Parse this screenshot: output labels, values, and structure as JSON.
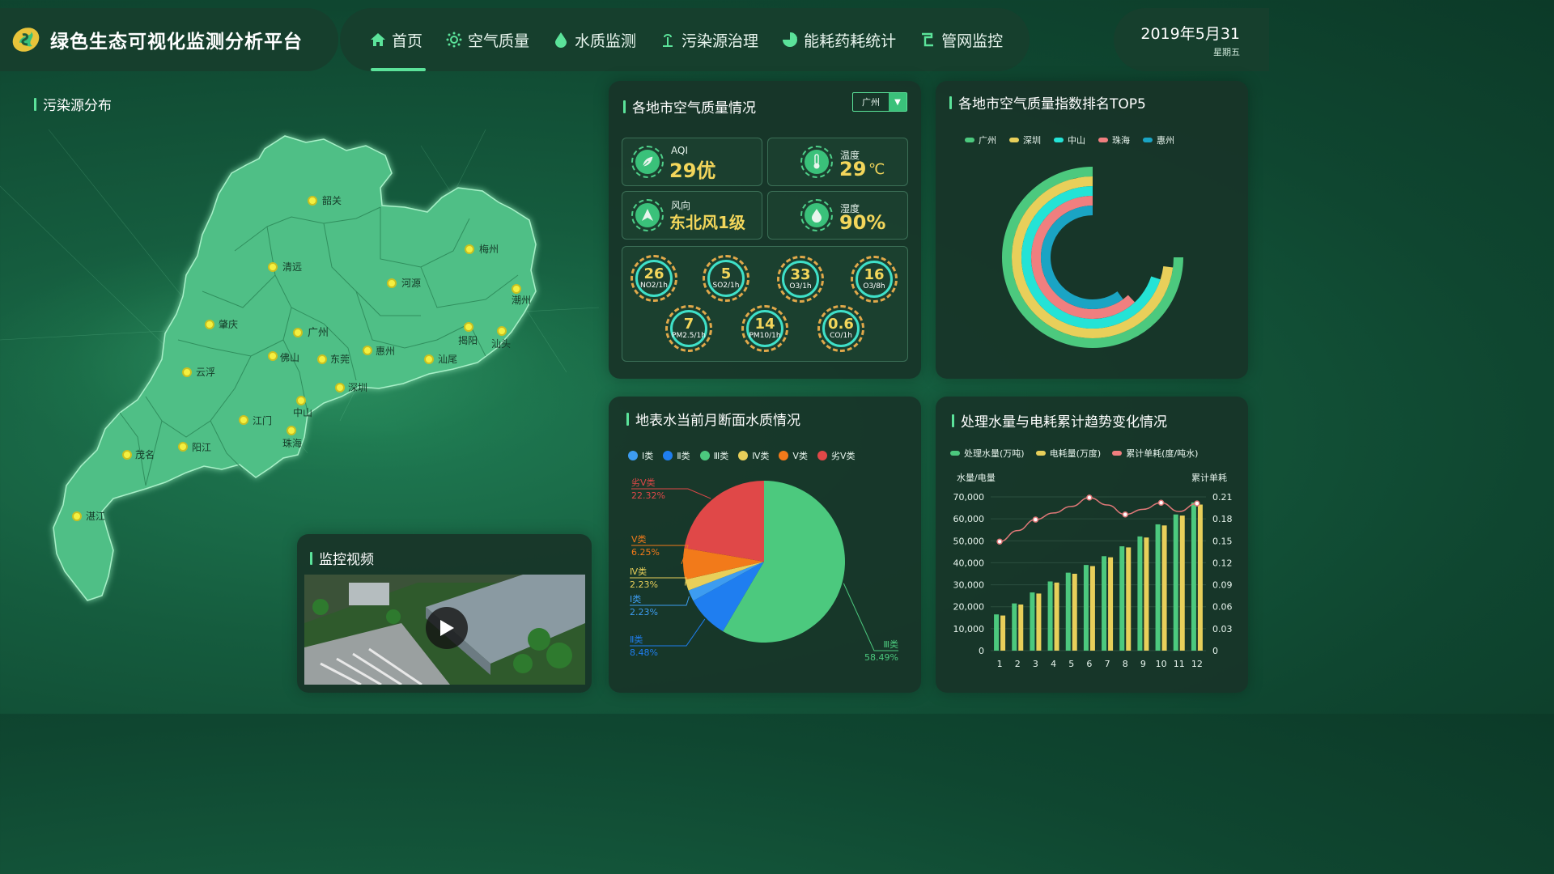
{
  "header": {
    "title": "绿色生态可视化监测分析平台",
    "nav": [
      {
        "label": "首页",
        "icon": "home-icon",
        "active": true
      },
      {
        "label": "空气质量",
        "icon": "air-icon"
      },
      {
        "label": "水质监测",
        "icon": "water-drop-icon"
      },
      {
        "label": "污染源治理",
        "icon": "pollution-icon"
      },
      {
        "label": "能耗药耗统计",
        "icon": "pie-icon"
      },
      {
        "label": "管网监控",
        "icon": "pipe-icon"
      }
    ],
    "date": "2019年5月31",
    "weekday": "星期五"
  },
  "map": {
    "title": "污染源分布",
    "cities": [
      "韶关",
      "清远",
      "梅州",
      "河源",
      "潮州",
      "肇庆",
      "广州",
      "揭阳",
      "汕头",
      "佛山",
      "东莞",
      "惠州",
      "汕尾",
      "云浮",
      "深圳",
      "中山",
      "江门",
      "珠海",
      "茂名",
      "阳江",
      "湛江"
    ]
  },
  "video": {
    "title": "监控视频"
  },
  "air": {
    "title": "各地市空气质量情况",
    "city_select": "广州",
    "aqi_label": "AQI",
    "aqi_value": "29优",
    "temp_label": "温度",
    "temp_value": "29",
    "temp_unit": "℃",
    "wind_label": "风向",
    "wind_value": "东北风1级",
    "humidity_label": "湿度",
    "humidity_value": "90%",
    "pollutants": [
      {
        "value": "26",
        "name": "NO2/1h"
      },
      {
        "value": "5",
        "name": "SO2/1h"
      },
      {
        "value": "33",
        "name": "O3/1h"
      },
      {
        "value": "16",
        "name": "O3/8h"
      },
      {
        "value": "7",
        "name": "PM2.5/1h"
      },
      {
        "value": "14",
        "name": "PM10/1h"
      },
      {
        "value": "0.6",
        "name": "CO/1h"
      }
    ]
  },
  "ranking": {
    "title": "各地市空气质量指数排名TOP5",
    "colors": {
      "广州": "#4cc97e",
      "深圳": "#e8cf5a",
      "中山": "#24e3d6",
      "珠海": "#f07f7f",
      "惠州": "#1aa4c4"
    }
  },
  "water": {
    "title": "地表水当前月断面水质情况",
    "legend": [
      "Ⅰ类",
      "Ⅱ类",
      "Ⅲ类",
      "Ⅳ类",
      "Ⅴ类",
      "劣Ⅴ类"
    ],
    "colors": [
      "#3d9cf0",
      "#1f7ef0",
      "#4cc97e",
      "#e8cf5a",
      "#f27a1a",
      "#e04848"
    ]
  },
  "trend": {
    "title": "处理水量与电耗累计趋势变化情况",
    "legend": [
      "处理水量(万吨)",
      "电耗量(万度)",
      "累计单耗(度/吨水)"
    ],
    "left_axis_title": "水量/电量",
    "right_axis_title": "累计单耗",
    "left_ticks": [
      "70,000",
      "60,000",
      "50,000",
      "40,000",
      "30,000",
      "20,000",
      "10,000",
      "0"
    ],
    "right_ticks": [
      "0.21",
      "0.18",
      "0.15",
      "0.12",
      "0.09",
      "0.06",
      "0.03",
      "0"
    ]
  },
  "chart_data": [
    {
      "type": "pie",
      "title": "地表水当前月断面水质情况",
      "categories": [
        "Ⅰ类",
        "Ⅱ类",
        "Ⅲ类",
        "Ⅳ类",
        "Ⅴ类",
        "劣Ⅴ类"
      ],
      "values": [
        2.23,
        8.48,
        58.49,
        2.23,
        6.25,
        22.32
      ],
      "labels": [
        "2.23%",
        "8.48%",
        "58.49%",
        "2.23%",
        "6.25%",
        "22.32%"
      ]
    },
    {
      "type": "bar",
      "title": "处理水量与电耗累计趋势变化情况",
      "categories": [
        "1",
        "2",
        "3",
        "4",
        "5",
        "6",
        "7",
        "8",
        "9",
        "10",
        "11",
        "12"
      ],
      "ylim": [
        0,
        70000
      ],
      "y2lim": [
        0,
        0.21
      ],
      "series": [
        {
          "name": "处理水量(万吨)",
          "type": "bar",
          "values": [
            16500,
            21500,
            26500,
            31500,
            35500,
            39000,
            43000,
            47500,
            52000,
            57500,
            62000,
            67500
          ]
        },
        {
          "name": "电耗量(万度)",
          "type": "bar",
          "values": [
            16000,
            21000,
            26000,
            31000,
            35000,
            38500,
            42500,
            47000,
            51500,
            57000,
            61500,
            66500
          ]
        },
        {
          "name": "累计单耗(度/吨水)",
          "type": "line",
          "axis": "right",
          "values": [
            0.149,
            0.164,
            0.179,
            0.188,
            0.197,
            0.209,
            0.199,
            0.186,
            0.193,
            0.202,
            0.19,
            0.201
          ]
        }
      ]
    },
    {
      "type": "pie",
      "title": "各地市空气质量指数排名TOP5",
      "categories": [
        "广州",
        "深圳",
        "中山",
        "珠海",
        "惠州"
      ],
      "values": [
        0.75,
        0.73,
        0.7,
        0.62,
        0.6
      ]
    }
  ]
}
